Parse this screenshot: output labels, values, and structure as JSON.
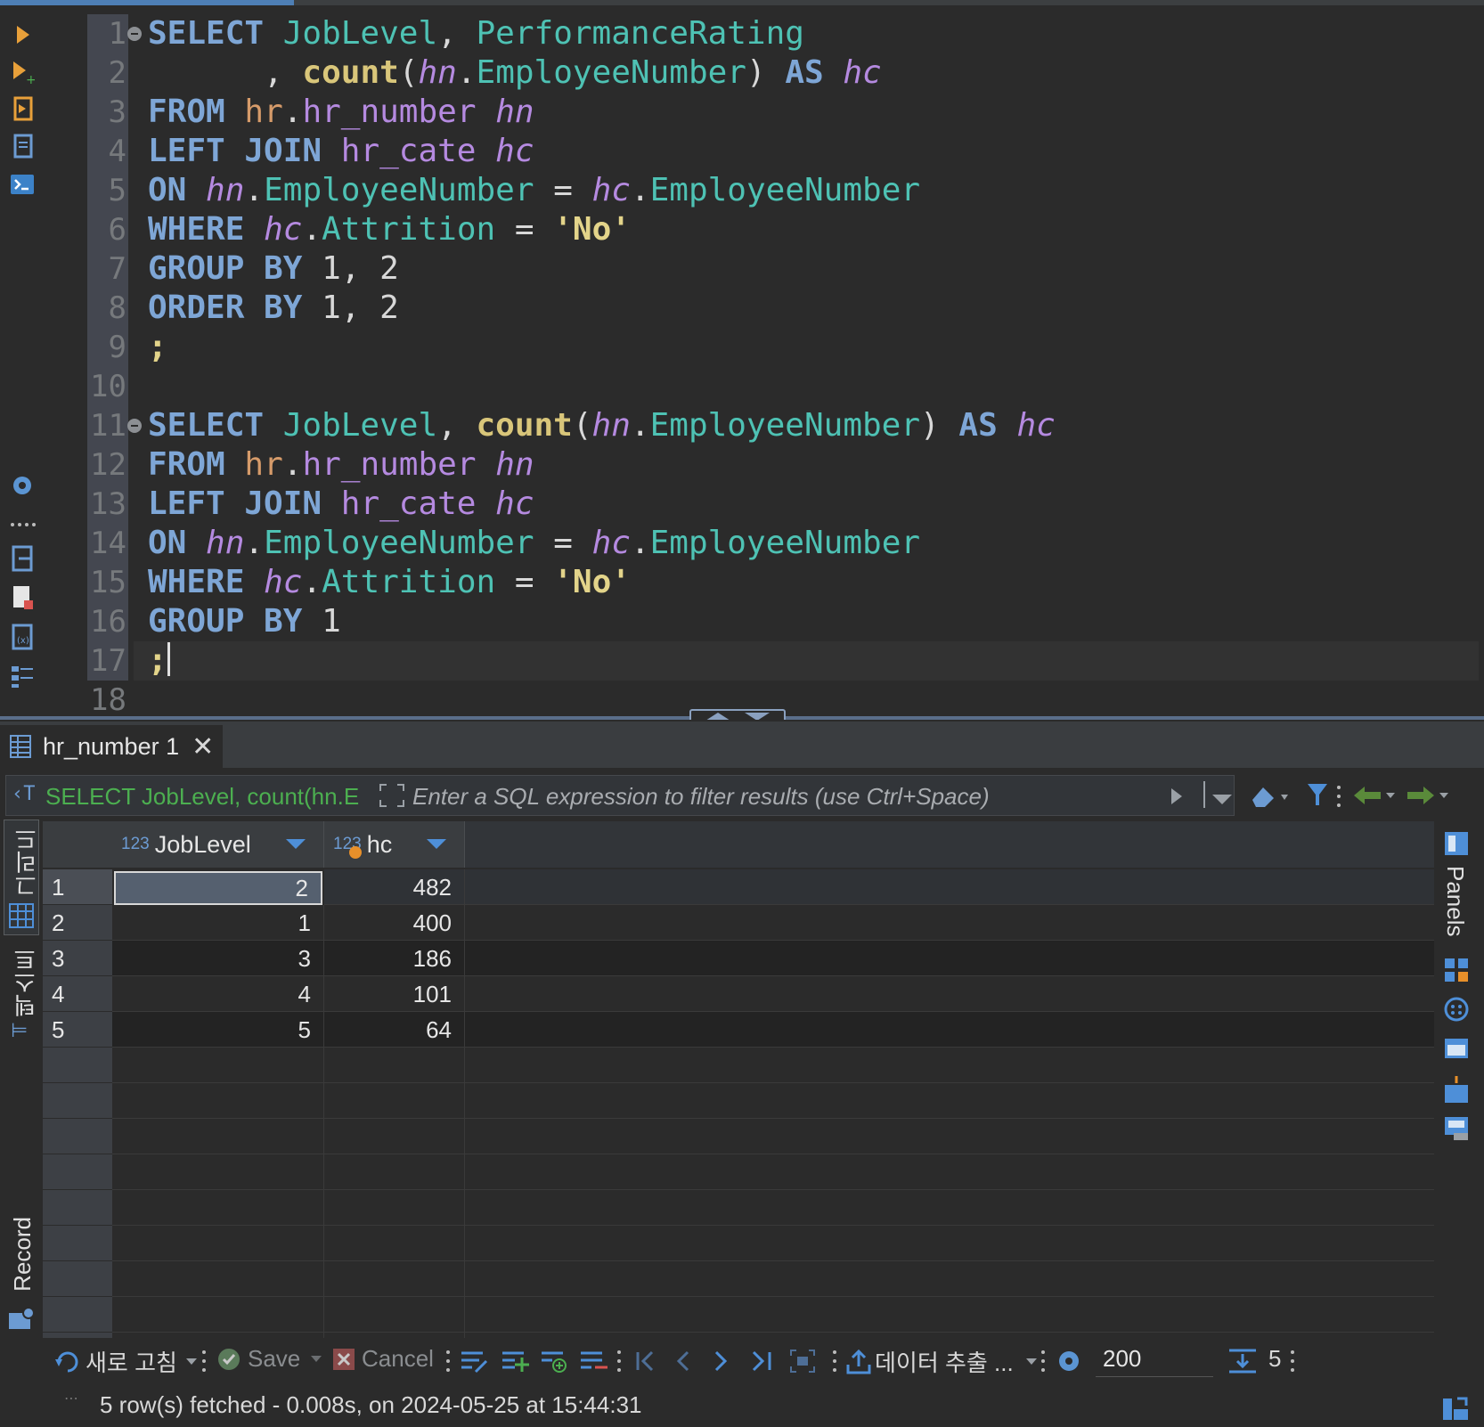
{
  "editor": {
    "line_numbers": [
      "1",
      "2",
      "3",
      "4",
      "5",
      "6",
      "7",
      "8",
      "9",
      "10",
      "11",
      "12",
      "13",
      "14",
      "15",
      "16",
      "17",
      "18"
    ],
    "query1": {
      "l1": {
        "kw_select": "SELECT",
        "c1": "JobLevel",
        "comma": ",",
        "c2": "PerformanceRating"
      },
      "l2": {
        "comma": ",",
        "fn": "count",
        "alias": "hn",
        "col": "EmployeeNumber",
        "as": "AS",
        "as_alias": "hc"
      },
      "l3": {
        "kw": "FROM",
        "schema": "hr",
        "table": "hr_number",
        "alias": "hn"
      },
      "l4": {
        "kw": "LEFT JOIN",
        "table": "hr_cate",
        "alias": "hc"
      },
      "l5": {
        "kw": "ON",
        "a1": "hn",
        "c1": "EmployeeNumber",
        "a2": "hc",
        "c2": "EmployeeNumber"
      },
      "l6": {
        "kw": "WHERE",
        "alias": "hc",
        "col": "Attrition",
        "str": "'No'"
      },
      "l7": {
        "kw": "GROUP BY",
        "nums": "1, 2"
      },
      "l8": {
        "kw": "ORDER BY",
        "nums": "1, 2"
      },
      "l9": {
        "semi": ";"
      }
    },
    "query2": {
      "l11": {
        "kw_select": "SELECT",
        "c1": "JobLevel",
        "fn": "count",
        "alias": "hn",
        "col": "EmployeeNumber",
        "as": "AS",
        "as_alias": "hc"
      },
      "l12": {
        "kw": "FROM",
        "schema": "hr",
        "table": "hr_number",
        "alias": "hn"
      },
      "l13": {
        "kw": "LEFT JOIN",
        "table": "hr_cate",
        "alias": "hc"
      },
      "l14": {
        "kw": "ON",
        "a1": "hn",
        "c1": "EmployeeNumber",
        "a2": "hc",
        "c2": "EmployeeNumber"
      },
      "l15": {
        "kw": "WHERE",
        "alias": "hc",
        "col": "Attrition",
        "str": "'No'"
      },
      "l16": {
        "kw": "GROUP BY",
        "nums": "1"
      },
      "l17": {
        "semi": ";"
      }
    }
  },
  "results": {
    "tab_label": "hr_number 1",
    "tab_close": "✕",
    "filter_query": "SELECT JobLevel, count(hn.E",
    "filter_placeholder": "Enter a SQL expression to filter results (use Ctrl+Space)",
    "side_tabs": {
      "grid": "그리드",
      "text": "텍스트",
      "record": "Record"
    },
    "panels_label": "Panels",
    "columns": [
      {
        "type": "123",
        "name": "JobLevel"
      },
      {
        "type": "123",
        "name": "hc"
      }
    ],
    "rows": [
      {
        "num": "1",
        "joblevel": "2",
        "hc": "482"
      },
      {
        "num": "2",
        "joblevel": "1",
        "hc": "400"
      },
      {
        "num": "3",
        "joblevel": "3",
        "hc": "186"
      },
      {
        "num": "4",
        "joblevel": "4",
        "hc": "101"
      },
      {
        "num": "5",
        "joblevel": "5",
        "hc": "64"
      }
    ]
  },
  "toolbar": {
    "refresh_label": "새로 고침",
    "save_label": "Save",
    "cancel_label": "Cancel",
    "export_label": "데이터 추출 ...",
    "fetch_size": "200",
    "row_count": "5"
  },
  "status": {
    "text": "5 row(s) fetched - 0.008s, on 2024-05-25 at 15:44:31"
  },
  "colors": {
    "keyword": "#7ea6d6",
    "column": "#4ec2b4",
    "alias": "#b58ae0",
    "function": "#d9c67a",
    "string": "#e3d48a",
    "accent_blue": "#4e8fd8",
    "query_green": "#4caf50"
  }
}
